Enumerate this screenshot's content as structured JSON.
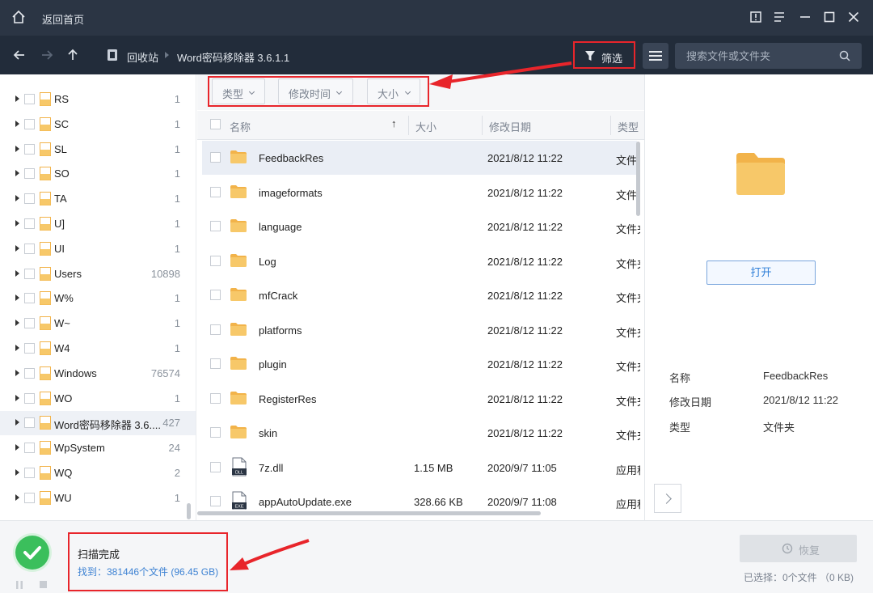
{
  "titlebar": {
    "back_home": "返回首页"
  },
  "navbar": {
    "crumbs": [
      "回收站",
      "Word密码移除器 3.6.1.1"
    ],
    "filter_label": "筛选",
    "search_placeholder": "搜索文件或文件夹"
  },
  "filters": {
    "type": "类型",
    "modified": "修改时间",
    "size": "大小"
  },
  "sidebar": {
    "items": [
      {
        "label": "RS",
        "count": "1"
      },
      {
        "label": "SC",
        "count": "1"
      },
      {
        "label": "SL",
        "count": "1"
      },
      {
        "label": "SO",
        "count": "1"
      },
      {
        "label": "TA",
        "count": "1"
      },
      {
        "label": "U]",
        "count": "1"
      },
      {
        "label": "UI",
        "count": "1"
      },
      {
        "label": "Users",
        "count": "10898"
      },
      {
        "label": "W%",
        "count": "1"
      },
      {
        "label": "W~",
        "count": "1"
      },
      {
        "label": "W4",
        "count": "1"
      },
      {
        "label": "Windows",
        "count": "76574"
      },
      {
        "label": "WO",
        "count": "1"
      },
      {
        "label": "Word密码移除器 3.6....",
        "count": "427"
      },
      {
        "label": "WpSystem",
        "count": "24"
      },
      {
        "label": "WQ",
        "count": "2"
      },
      {
        "label": "WU",
        "count": "1"
      }
    ]
  },
  "list": {
    "headers": {
      "name": "名称",
      "size": "大小",
      "date": "修改日期",
      "type": "类型"
    },
    "rows": [
      {
        "name": "FeedbackRes",
        "size": "",
        "date": "2021/8/12 11:22",
        "type": "文件夹",
        "kind": "folder"
      },
      {
        "name": "imageformats",
        "size": "",
        "date": "2021/8/12 11:22",
        "type": "文件夹",
        "kind": "folder"
      },
      {
        "name": "language",
        "size": "",
        "date": "2021/8/12 11:22",
        "type": "文件夹",
        "kind": "folder"
      },
      {
        "name": "Log",
        "size": "",
        "date": "2021/8/12 11:22",
        "type": "文件夹",
        "kind": "folder"
      },
      {
        "name": "mfCrack",
        "size": "",
        "date": "2021/8/12 11:22",
        "type": "文件夹",
        "kind": "folder"
      },
      {
        "name": "platforms",
        "size": "",
        "date": "2021/8/12 11:22",
        "type": "文件夹",
        "kind": "folder"
      },
      {
        "name": "plugin",
        "size": "",
        "date": "2021/8/12 11:22",
        "type": "文件夹",
        "kind": "folder"
      },
      {
        "name": "RegisterRes",
        "size": "",
        "date": "2021/8/12 11:22",
        "type": "文件夹",
        "kind": "folder"
      },
      {
        "name": "skin",
        "size": "",
        "date": "2021/8/12 11:22",
        "type": "文件夹",
        "kind": "folder"
      },
      {
        "name": "7z.dll",
        "size": "1.15 MB",
        "date": "2020/9/7 11:05",
        "type": "应用程",
        "kind": "DLL"
      },
      {
        "name": "appAutoUpdate.exe",
        "size": "328.66 KB",
        "date": "2020/9/7 11:08",
        "type": "应用程",
        "kind": "EXE"
      }
    ]
  },
  "preview": {
    "open_label": "打开",
    "info": [
      {
        "key": "名称",
        "value": "FeedbackRes"
      },
      {
        "key": "修改日期",
        "value": "2021/8/12 11:22"
      },
      {
        "key": "类型",
        "value": "文件夹"
      }
    ]
  },
  "status": {
    "title": "扫描完成",
    "found": "找到：381446个文件 (96.45 GB)",
    "recover_label": "恢复",
    "selected": "已选择：0个文件 （0 KB)"
  },
  "colors": {
    "titlebar": "#2b3544",
    "navbar": "#222c3a",
    "annotation_red": "#e8252b",
    "folder_yellow": "#f5c25c",
    "link_blue": "#3d82d3",
    "success_green": "#3bbf5c"
  }
}
